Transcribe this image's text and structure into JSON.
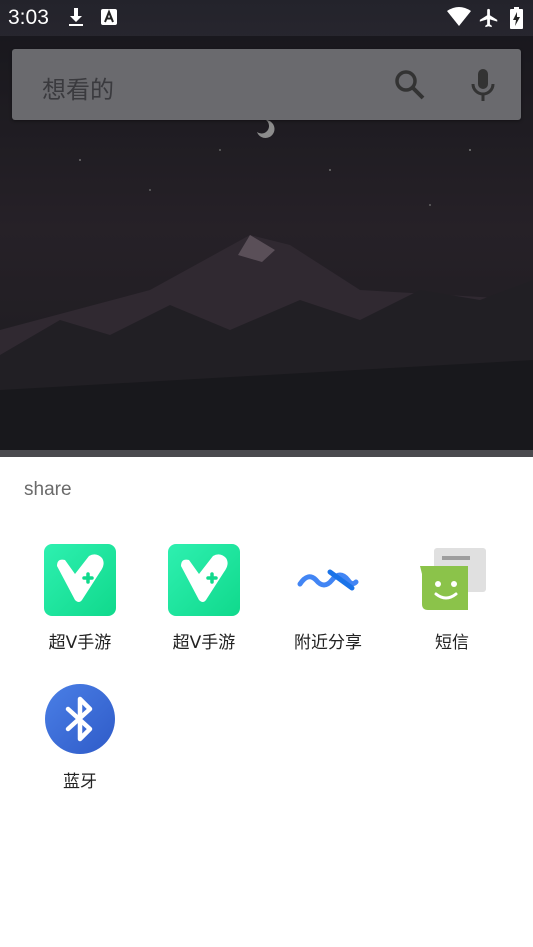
{
  "status_bar": {
    "time": "3:03",
    "icons": [
      "download-icon",
      "text-a-icon",
      "wifi-icon",
      "airplane-icon",
      "battery-charging-icon"
    ]
  },
  "search": {
    "hint": "想看的",
    "icons": [
      "search-icon",
      "mic-icon"
    ]
  },
  "share_sheet": {
    "title": "share",
    "targets": [
      {
        "label": "超V手游",
        "icon": "chaov-app-icon",
        "color": "#1de9a0"
      },
      {
        "label": "超V手游",
        "icon": "chaov-app-icon",
        "color": "#1de9a0"
      },
      {
        "label": "附近分享",
        "icon": "nearby-share-icon",
        "color": "#1a73e8"
      },
      {
        "label": "短信",
        "icon": "messages-icon",
        "color": "#8bc34a"
      },
      {
        "label": "蓝牙",
        "icon": "bluetooth-icon",
        "color": "#3b6fd9"
      }
    ]
  },
  "colors": {
    "sheet_background": "#ffffff",
    "label_text": "#222222",
    "title_text": "#6b6b6b"
  }
}
